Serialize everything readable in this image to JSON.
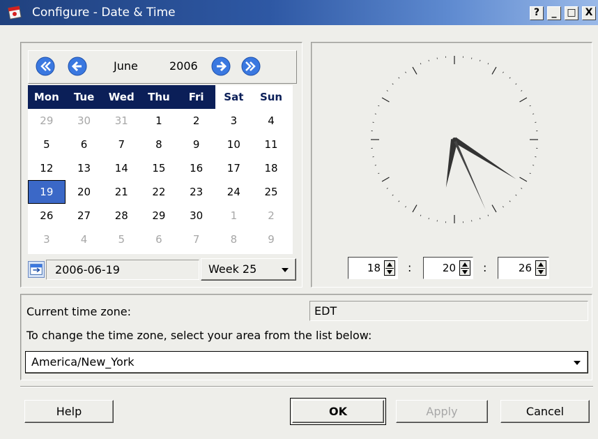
{
  "window": {
    "title": "Configure - Date & Time",
    "controls": {
      "help": "?",
      "minimize": "_",
      "maximize": "□",
      "close": "X"
    }
  },
  "calendar": {
    "month": "June",
    "year": "2006",
    "nav": [
      "prev-year-icon",
      "prev-month-icon",
      "next-month-icon",
      "next-year-icon"
    ],
    "weekdays": [
      "Mon",
      "Tue",
      "Wed",
      "Thu",
      "Fri",
      "Sat",
      "Sun"
    ],
    "weeks": [
      [
        "29",
        "30",
        "31",
        "1",
        "2",
        "3",
        "4"
      ],
      [
        "5",
        "6",
        "7",
        "8",
        "9",
        "10",
        "11"
      ],
      [
        "12",
        "13",
        "14",
        "15",
        "16",
        "17",
        "18"
      ],
      [
        "19",
        "20",
        "21",
        "22",
        "23",
        "24",
        "25"
      ],
      [
        "26",
        "27",
        "28",
        "29",
        "30",
        "1",
        "2"
      ],
      [
        "3",
        "4",
        "5",
        "6",
        "7",
        "8",
        "9"
      ]
    ],
    "selected_date": "2006-06-19",
    "week": "Week 25"
  },
  "time": {
    "hour": "18",
    "minute": "20",
    "second": "26",
    "separator": ":"
  },
  "timezone": {
    "current_label": "Current time zone:",
    "current_value": "EDT",
    "instruction": "To change the time zone, select your area from the list below:",
    "selected": "America/New_York"
  },
  "buttons": {
    "help": "Help",
    "ok": "OK",
    "apply": "Apply",
    "cancel": "Cancel"
  },
  "colors": {
    "title_bar": "#2e58a4",
    "header_bg": "#0b1f58",
    "selection": "#3b68c7"
  }
}
